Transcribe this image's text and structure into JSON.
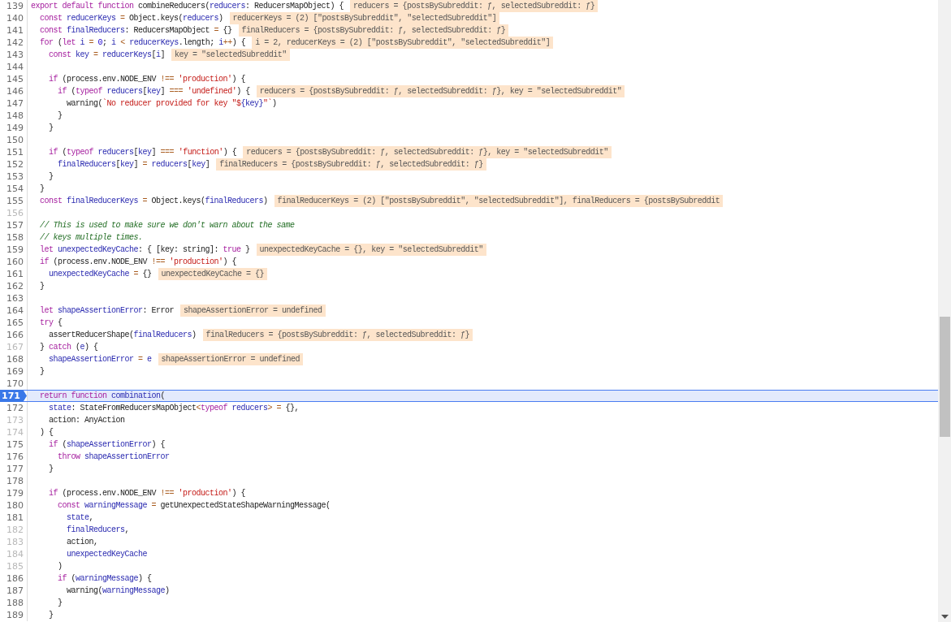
{
  "lines": [
    {
      "number": "139",
      "dimmed": false,
      "selected": false,
      "tokens": [
        {
          "kind": "k",
          "text": "export default function "
        },
        {
          "kind": "p",
          "text": "combineReducers("
        },
        {
          "kind": "v",
          "text": "reducers"
        },
        {
          "kind": "p",
          "text": ": ReducersMapObject) {"
        }
      ],
      "value": "reducers = {postsBySubreddit: ƒ, selectedSubreddit: ƒ}"
    },
    {
      "number": "140",
      "dimmed": false,
      "selected": false,
      "tokens": [
        {
          "kind": "k",
          "text": "  const "
        },
        {
          "kind": "v",
          "text": "reducerKeys "
        },
        {
          "kind": "o",
          "text": "= "
        },
        {
          "kind": "p",
          "text": "Object.keys("
        },
        {
          "kind": "v",
          "text": "reducers"
        },
        {
          "kind": "p",
          "text": ")"
        }
      ],
      "value": "reducerKeys = (2) [\"postsBySubreddit\", \"selectedSubreddit\"]"
    },
    {
      "number": "141",
      "dimmed": false,
      "selected": false,
      "tokens": [
        {
          "kind": "k",
          "text": "  const "
        },
        {
          "kind": "v",
          "text": "finalReducers"
        },
        {
          "kind": "p",
          "text": ": ReducersMapObject "
        },
        {
          "kind": "o",
          "text": "="
        },
        {
          "kind": "p",
          "text": " {}"
        }
      ],
      "value": "finalReducers = {postsBySubreddit: ƒ, selectedSubreddit: ƒ}"
    },
    {
      "number": "142",
      "dimmed": false,
      "selected": false,
      "tokens": [
        {
          "kind": "k",
          "text": "  for "
        },
        {
          "kind": "p",
          "text": "("
        },
        {
          "kind": "k",
          "text": "let "
        },
        {
          "kind": "v",
          "text": "i "
        },
        {
          "kind": "o",
          "text": "= "
        },
        {
          "kind": "n",
          "text": "0"
        },
        {
          "kind": "p",
          "text": "; "
        },
        {
          "kind": "v",
          "text": "i "
        },
        {
          "kind": "o",
          "text": "< "
        },
        {
          "kind": "v",
          "text": "reducerKeys"
        },
        {
          "kind": "p",
          "text": ".length; "
        },
        {
          "kind": "v",
          "text": "i"
        },
        {
          "kind": "o",
          "text": "++"
        },
        {
          "kind": "p",
          "text": ") {"
        }
      ],
      "value": "i = 2, reducerKeys = (2) [\"postsBySubreddit\", \"selectedSubreddit\"]"
    },
    {
      "number": "143",
      "dimmed": false,
      "selected": false,
      "tokens": [
        {
          "kind": "k",
          "text": "    const "
        },
        {
          "kind": "v",
          "text": "key "
        },
        {
          "kind": "o",
          "text": "= "
        },
        {
          "kind": "v",
          "text": "reducerKeys"
        },
        {
          "kind": "p",
          "text": "["
        },
        {
          "kind": "v",
          "text": "i"
        },
        {
          "kind": "p",
          "text": "]"
        }
      ],
      "value": "key = \"selectedSubreddit\""
    },
    {
      "number": "144",
      "dimmed": false,
      "selected": false
    },
    {
      "number": "145",
      "dimmed": false,
      "selected": false,
      "tokens": [
        {
          "kind": "k",
          "text": "    if "
        },
        {
          "kind": "p",
          "text": "(process.env.NODE_ENV "
        },
        {
          "kind": "o",
          "text": "!== "
        },
        {
          "kind": "s",
          "text": "'production'"
        },
        {
          "kind": "p",
          "text": ") {"
        }
      ]
    },
    {
      "number": "146",
      "dimmed": false,
      "selected": false,
      "tokens": [
        {
          "kind": "k",
          "text": "      if "
        },
        {
          "kind": "p",
          "text": "("
        },
        {
          "kind": "k",
          "text": "typeof "
        },
        {
          "kind": "v",
          "text": "reducers"
        },
        {
          "kind": "p",
          "text": "["
        },
        {
          "kind": "v",
          "text": "key"
        },
        {
          "kind": "p",
          "text": "] "
        },
        {
          "kind": "o",
          "text": "=== "
        },
        {
          "kind": "s",
          "text": "'undefined'"
        },
        {
          "kind": "p",
          "text": ") {"
        }
      ],
      "value": "reducers = {postsBySubreddit: ƒ, selectedSubreddit: ƒ}, key = \"selectedSubreddit\""
    },
    {
      "number": "147",
      "dimmed": false,
      "selected": false,
      "tokens": [
        {
          "kind": "p",
          "text": "        warning("
        },
        {
          "kind": "s",
          "text": "`No reducer provided for key \"$"
        },
        {
          "kind": "v",
          "text": "{key}"
        },
        {
          "kind": "s",
          "text": "\"`"
        },
        {
          "kind": "p",
          "text": ")"
        }
      ]
    },
    {
      "number": "148",
      "dimmed": false,
      "selected": false,
      "tokens": [
        {
          "kind": "p",
          "text": "      }"
        }
      ]
    },
    {
      "number": "149",
      "dimmed": false,
      "selected": false,
      "tokens": [
        {
          "kind": "p",
          "text": "    }"
        }
      ]
    },
    {
      "number": "150",
      "dimmed": false,
      "selected": false
    },
    {
      "number": "151",
      "dimmed": false,
      "selected": false,
      "tokens": [
        {
          "kind": "k",
          "text": "    if "
        },
        {
          "kind": "p",
          "text": "("
        },
        {
          "kind": "k",
          "text": "typeof "
        },
        {
          "kind": "v",
          "text": "reducers"
        },
        {
          "kind": "p",
          "text": "["
        },
        {
          "kind": "v",
          "text": "key"
        },
        {
          "kind": "p",
          "text": "] "
        },
        {
          "kind": "o",
          "text": "=== "
        },
        {
          "kind": "s",
          "text": "'function'"
        },
        {
          "kind": "p",
          "text": ") {"
        }
      ],
      "value": "reducers = {postsBySubreddit: ƒ, selectedSubreddit: ƒ}, key = \"selectedSubreddit\""
    },
    {
      "number": "152",
      "dimmed": false,
      "selected": false,
      "tokens": [
        {
          "kind": "v",
          "text": "      finalReducers"
        },
        {
          "kind": "p",
          "text": "["
        },
        {
          "kind": "v",
          "text": "key"
        },
        {
          "kind": "p",
          "text": "] "
        },
        {
          "kind": "o",
          "text": "= "
        },
        {
          "kind": "v",
          "text": "reducers"
        },
        {
          "kind": "p",
          "text": "["
        },
        {
          "kind": "v",
          "text": "key"
        },
        {
          "kind": "p",
          "text": "]"
        }
      ],
      "value": "finalReducers = {postsBySubreddit: ƒ, selectedSubreddit: ƒ}"
    },
    {
      "number": "153",
      "dimmed": false,
      "selected": false,
      "tokens": [
        {
          "kind": "p",
          "text": "    }"
        }
      ]
    },
    {
      "number": "154",
      "dimmed": false,
      "selected": false,
      "tokens": [
        {
          "kind": "p",
          "text": "  }"
        }
      ]
    },
    {
      "number": "155",
      "dimmed": false,
      "selected": false,
      "tokens": [
        {
          "kind": "k",
          "text": "  const "
        },
        {
          "kind": "v",
          "text": "finalReducerKeys "
        },
        {
          "kind": "o",
          "text": "= "
        },
        {
          "kind": "p",
          "text": "Object.keys("
        },
        {
          "kind": "v",
          "text": "finalReducers"
        },
        {
          "kind": "p",
          "text": ")"
        }
      ],
      "value": "finalReducerKeys = (2) [\"postsBySubreddit\", \"selectedSubreddit\"], finalReducers = {postsBySubreddit"
    },
    {
      "number": "156",
      "dimmed": true,
      "selected": false
    },
    {
      "number": "157",
      "dimmed": false,
      "selected": false,
      "tokens": [
        {
          "kind": "c",
          "text": "  // This is used to make sure we don't warn about the same"
        }
      ]
    },
    {
      "number": "158",
      "dimmed": false,
      "selected": false,
      "tokens": [
        {
          "kind": "c",
          "text": "  // keys multiple times."
        }
      ]
    },
    {
      "number": "159",
      "dimmed": false,
      "selected": false,
      "tokens": [
        {
          "kind": "k",
          "text": "  let "
        },
        {
          "kind": "v",
          "text": "unexpectedKeyCache"
        },
        {
          "kind": "p",
          "text": ": { [key: string]: "
        },
        {
          "kind": "k",
          "text": "true"
        },
        {
          "kind": "p",
          "text": " }"
        }
      ],
      "value": "unexpectedKeyCache = {}, key = \"selectedSubreddit\""
    },
    {
      "number": "160",
      "dimmed": false,
      "selected": false,
      "tokens": [
        {
          "kind": "k",
          "text": "  if "
        },
        {
          "kind": "p",
          "text": "(process.env.NODE_ENV "
        },
        {
          "kind": "o",
          "text": "!== "
        },
        {
          "kind": "s",
          "text": "'production'"
        },
        {
          "kind": "p",
          "text": ") {"
        }
      ]
    },
    {
      "number": "161",
      "dimmed": false,
      "selected": false,
      "tokens": [
        {
          "kind": "v",
          "text": "    unexpectedKeyCache "
        },
        {
          "kind": "o",
          "text": "="
        },
        {
          "kind": "p",
          "text": " {}"
        }
      ],
      "value": "unexpectedKeyCache = {}"
    },
    {
      "number": "162",
      "dimmed": false,
      "selected": false,
      "tokens": [
        {
          "kind": "p",
          "text": "  }"
        }
      ]
    },
    {
      "number": "163",
      "dimmed": false,
      "selected": false
    },
    {
      "number": "164",
      "dimmed": false,
      "selected": false,
      "tokens": [
        {
          "kind": "k",
          "text": "  let "
        },
        {
          "kind": "v",
          "text": "shapeAssertionError"
        },
        {
          "kind": "p",
          "text": ": Error"
        }
      ],
      "value": "shapeAssertionError = undefined"
    },
    {
      "number": "165",
      "dimmed": false,
      "selected": false,
      "tokens": [
        {
          "kind": "k",
          "text": "  try"
        },
        {
          "kind": "p",
          "text": " {"
        }
      ]
    },
    {
      "number": "166",
      "dimmed": false,
      "selected": false,
      "tokens": [
        {
          "kind": "p",
          "text": "    assertReducerShape("
        },
        {
          "kind": "v",
          "text": "finalReducers"
        },
        {
          "kind": "p",
          "text": ")"
        }
      ],
      "value": "finalReducers = {postsBySubreddit: ƒ, selectedSubreddit: ƒ}"
    },
    {
      "number": "167",
      "dimmed": true,
      "selected": false,
      "tokens": [
        {
          "kind": "p",
          "text": "  } "
        },
        {
          "kind": "k",
          "text": "catch"
        },
        {
          "kind": "p",
          "text": " ("
        },
        {
          "kind": "v",
          "text": "e"
        },
        {
          "kind": "p",
          "text": ") {"
        }
      ]
    },
    {
      "number": "168",
      "dimmed": false,
      "selected": false,
      "tokens": [
        {
          "kind": "v",
          "text": "    shapeAssertionError "
        },
        {
          "kind": "o",
          "text": "= "
        },
        {
          "kind": "v",
          "text": "e"
        }
      ],
      "value": "shapeAssertionError = undefined"
    },
    {
      "number": "169",
      "dimmed": false,
      "selected": false,
      "tokens": [
        {
          "kind": "p",
          "text": "  }"
        }
      ]
    },
    {
      "number": "170",
      "dimmed": false,
      "selected": false
    },
    {
      "number": "171",
      "dimmed": false,
      "selected": true,
      "tokens": [
        {
          "kind": "k",
          "text": "  return function "
        },
        {
          "kind": "v",
          "text": "combination"
        },
        {
          "kind": "p",
          "text": "("
        }
      ]
    },
    {
      "number": "172",
      "dimmed": false,
      "selected": false,
      "tokens": [
        {
          "kind": "v",
          "text": "    state"
        },
        {
          "kind": "p",
          "text": ": StateFromReducersMapObject"
        },
        {
          "kind": "o",
          "text": "<"
        },
        {
          "kind": "k",
          "text": "typeof "
        },
        {
          "kind": "v",
          "text": "reducers"
        },
        {
          "kind": "o",
          "text": "> ="
        },
        {
          "kind": "p",
          "text": " {},"
        }
      ]
    },
    {
      "number": "173",
      "dimmed": true,
      "selected": false,
      "tokens": [
        {
          "kind": "p",
          "text": "    action: AnyAction"
        }
      ]
    },
    {
      "number": "174",
      "dimmed": true,
      "selected": false,
      "tokens": [
        {
          "kind": "p",
          "text": "  ) {"
        }
      ]
    },
    {
      "number": "175",
      "dimmed": false,
      "selected": false,
      "tokens": [
        {
          "kind": "k",
          "text": "    if "
        },
        {
          "kind": "p",
          "text": "("
        },
        {
          "kind": "v",
          "text": "shapeAssertionError"
        },
        {
          "kind": "p",
          "text": ") {"
        }
      ]
    },
    {
      "number": "176",
      "dimmed": false,
      "selected": false,
      "tokens": [
        {
          "kind": "k",
          "text": "      throw "
        },
        {
          "kind": "v",
          "text": "shapeAssertionError"
        }
      ]
    },
    {
      "number": "177",
      "dimmed": false,
      "selected": false,
      "tokens": [
        {
          "kind": "p",
          "text": "    }"
        }
      ]
    },
    {
      "number": "178",
      "dimmed": false,
      "selected": false
    },
    {
      "number": "179",
      "dimmed": false,
      "selected": false,
      "tokens": [
        {
          "kind": "k",
          "text": "    if "
        },
        {
          "kind": "p",
          "text": "(process.env.NODE_ENV "
        },
        {
          "kind": "o",
          "text": "!== "
        },
        {
          "kind": "s",
          "text": "'production'"
        },
        {
          "kind": "p",
          "text": ") {"
        }
      ]
    },
    {
      "number": "180",
      "dimmed": false,
      "selected": false,
      "tokens": [
        {
          "kind": "k",
          "text": "      const "
        },
        {
          "kind": "v",
          "text": "warningMessage "
        },
        {
          "kind": "o",
          "text": "="
        },
        {
          "kind": "p",
          "text": " getUnexpectedStateShapeWarningMessage("
        }
      ]
    },
    {
      "number": "181",
      "dimmed": false,
      "selected": false,
      "tokens": [
        {
          "kind": "v",
          "text": "        state"
        },
        {
          "kind": "p",
          "text": ","
        }
      ]
    },
    {
      "number": "182",
      "dimmed": true,
      "selected": false,
      "tokens": [
        {
          "kind": "v",
          "text": "        finalReducers"
        },
        {
          "kind": "p",
          "text": ","
        }
      ]
    },
    {
      "number": "183",
      "dimmed": true,
      "selected": false,
      "tokens": [
        {
          "kind": "p",
          "text": "        action,"
        }
      ]
    },
    {
      "number": "184",
      "dimmed": true,
      "selected": false,
      "tokens": [
        {
          "kind": "v",
          "text": "        unexpectedKeyCache"
        }
      ]
    },
    {
      "number": "185",
      "dimmed": true,
      "selected": false,
      "tokens": [
        {
          "kind": "p",
          "text": "      )"
        }
      ]
    },
    {
      "number": "186",
      "dimmed": false,
      "selected": false,
      "tokens": [
        {
          "kind": "k",
          "text": "      if "
        },
        {
          "kind": "p",
          "text": "("
        },
        {
          "kind": "v",
          "text": "warningMessage"
        },
        {
          "kind": "p",
          "text": ") {"
        }
      ]
    },
    {
      "number": "187",
      "dimmed": false,
      "selected": false,
      "tokens": [
        {
          "kind": "p",
          "text": "        warning("
        },
        {
          "kind": "v",
          "text": "warningMessage"
        },
        {
          "kind": "p",
          "text": ")"
        }
      ]
    },
    {
      "number": "188",
      "dimmed": false,
      "selected": false,
      "tokens": [
        {
          "kind": "p",
          "text": "      }"
        }
      ]
    },
    {
      "number": "189",
      "dimmed": false,
      "selected": false,
      "tokens": [
        {
          "kind": "p",
          "text": "    }"
        }
      ]
    }
  ]
}
